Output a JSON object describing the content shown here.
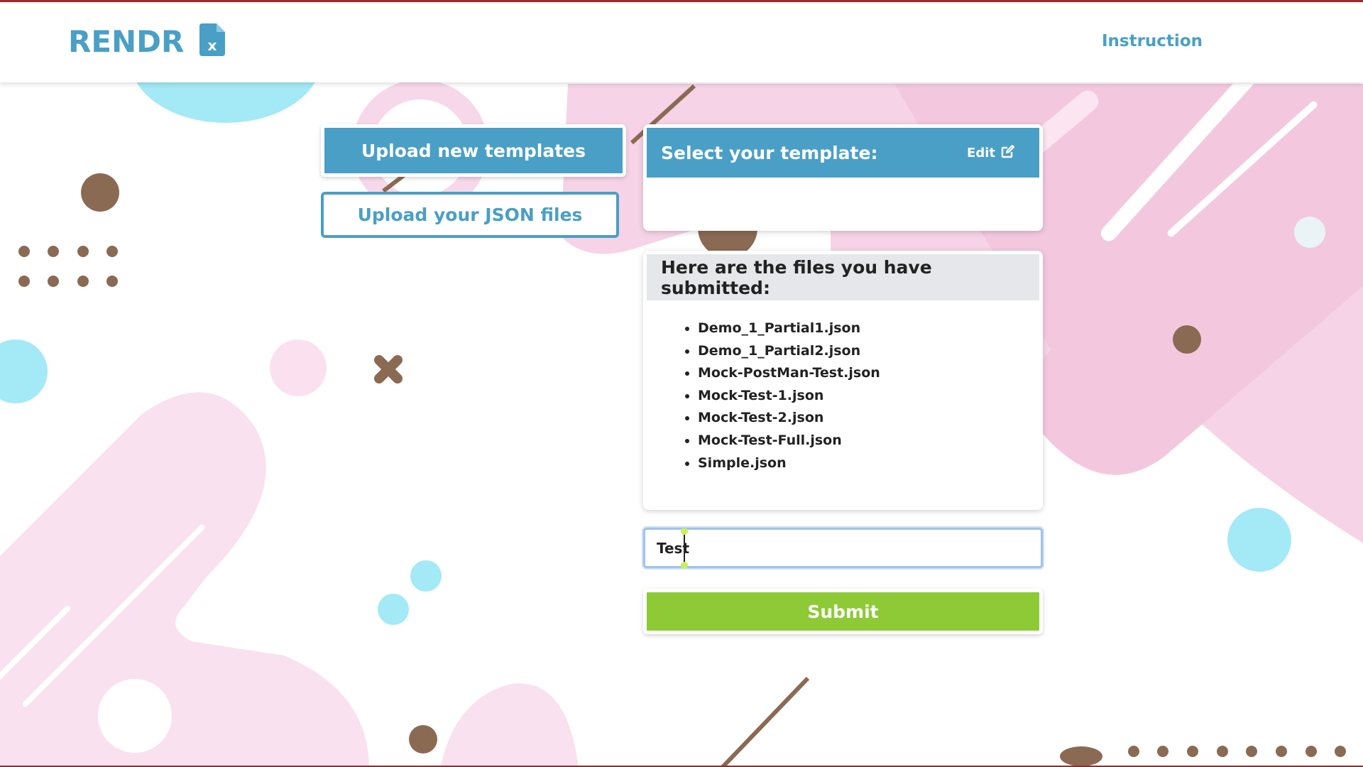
{
  "header": {
    "brand": "RENDR",
    "logo_icon": "excel-file-icon",
    "nav_link": "Instruction"
  },
  "actions": {
    "upload_templates_label": "Upload new templates",
    "upload_json_label": "Upload your JSON files"
  },
  "template_panel": {
    "title": "Select your template:",
    "edit_label": "Edit",
    "edit_icon": "edit-icon"
  },
  "files_panel": {
    "title": "Here are the files you have submitted:",
    "files": [
      "Demo_1_Partial1.json",
      "Demo_1_Partial2.json",
      "Mock-PostMan-Test.json",
      "Mock-Test-1.json",
      "Mock-Test-2.json",
      "Mock-Test-Full.json",
      "Simple.json"
    ]
  },
  "name_input": {
    "value": "Test"
  },
  "submit": {
    "label": "Submit"
  },
  "colors": {
    "brand_blue": "#4a9fc6",
    "submit_green": "#8dca35",
    "accent_pink": "#f6d3e6",
    "accent_cyan": "#9fe8f5",
    "accent_brown": "#8b6a54",
    "border_red": "#a0262b"
  }
}
